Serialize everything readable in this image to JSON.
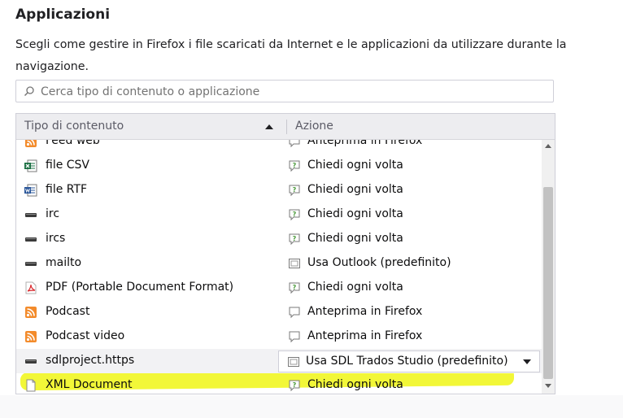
{
  "section": {
    "title": "Applicazioni",
    "description": "Scegli come gestire in Firefox i file scaricati da Internet e le applicazioni da utilizzare durante la navigazione."
  },
  "search": {
    "placeholder": "Cerca tipo di contenuto o applicazione",
    "value": ""
  },
  "table": {
    "headers": {
      "type": "Tipo di contenuto",
      "action": "Azione"
    },
    "sort": "ascending",
    "rows": [
      {
        "type": "Feed web",
        "type_icon": "rss-icon",
        "action": "Anteprima in Firefox",
        "action_icon": "feed-preview-icon"
      },
      {
        "type": "file CSV",
        "type_icon": "excel-icon",
        "action": "Chiedi ogni volta",
        "action_icon": "ask-icon"
      },
      {
        "type": "file RTF",
        "type_icon": "word-icon",
        "action": "Chiedi ogni volta",
        "action_icon": "ask-icon"
      },
      {
        "type": "irc",
        "type_icon": "protocol-icon",
        "action": "Chiedi ogni volta",
        "action_icon": "ask-icon"
      },
      {
        "type": "ircs",
        "type_icon": "protocol-icon",
        "action": "Chiedi ogni volta",
        "action_icon": "ask-icon"
      },
      {
        "type": "mailto",
        "type_icon": "protocol-icon",
        "action": "Usa Outlook (predefinito)",
        "action_icon": "app-icon"
      },
      {
        "type": "PDF (Portable Document Format)",
        "type_icon": "pdf-icon",
        "action": "Chiedi ogni volta",
        "action_icon": "ask-icon"
      },
      {
        "type": "Podcast",
        "type_icon": "rss-icon",
        "action": "Anteprima in Firefox",
        "action_icon": "feed-preview-icon"
      },
      {
        "type": "Podcast video",
        "type_icon": "rss-icon",
        "action": "Anteprima in Firefox",
        "action_icon": "feed-preview-icon"
      },
      {
        "type": "sdlproject.https",
        "type_icon": "protocol-icon",
        "action": "Usa SDL Trados Studio (predefinito)",
        "action_icon": "app-icon",
        "selected": true
      },
      {
        "type": "XML Document",
        "type_icon": "document-icon",
        "action": "Chiedi ogni volta",
        "action_icon": "ask-icon"
      }
    ]
  },
  "colors": {
    "highlight": "#eef500",
    "rss": "#f38b2b",
    "excel": "#1e7145",
    "word": "#2b579a",
    "pdf": "#d9262b",
    "ask": "#4a9a3a",
    "header_bg": "#ededf0"
  }
}
